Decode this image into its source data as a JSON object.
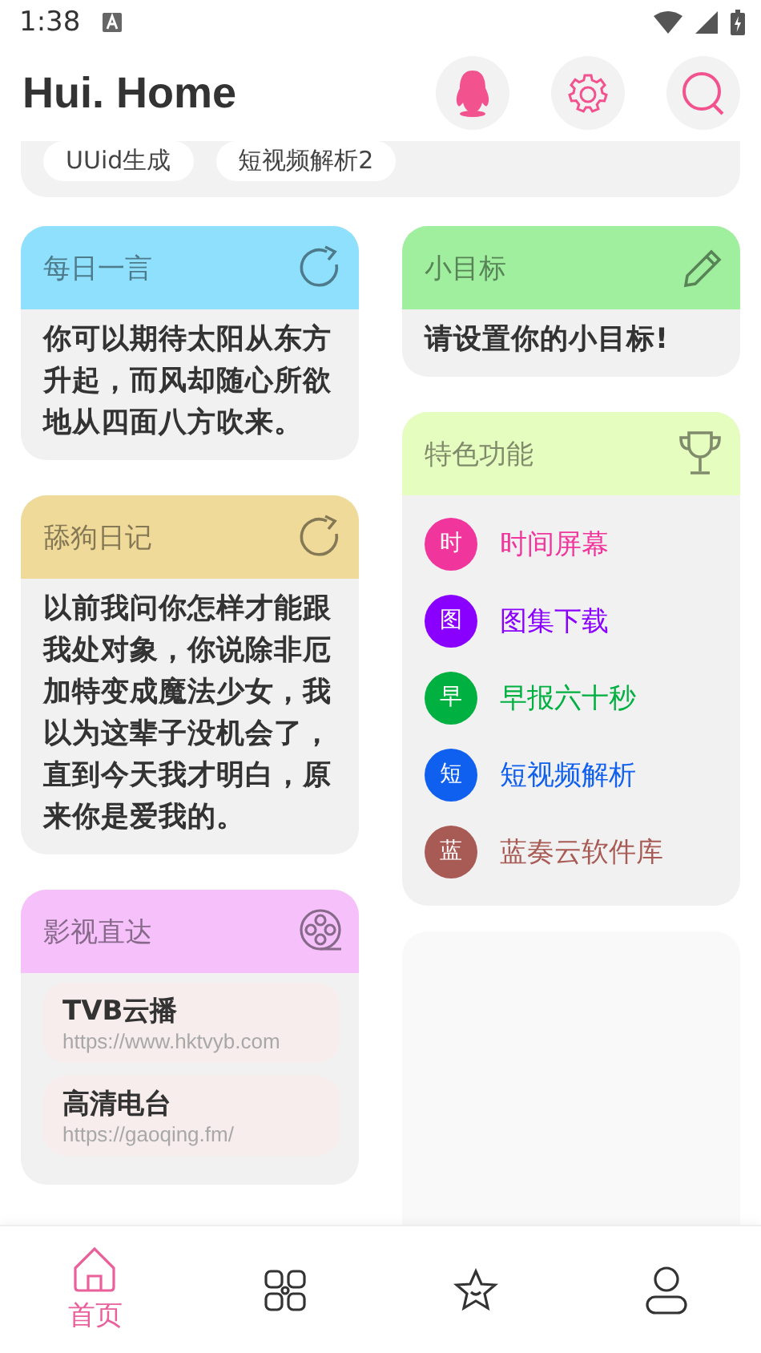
{
  "status_bar": {
    "time": "1:38"
  },
  "header": {
    "title": "Hui. Home"
  },
  "top_chips": [
    "UUid生成",
    "短视频解析2"
  ],
  "left_cards": [
    {
      "kind": "text",
      "title": "每日一言",
      "color": "#8ee0fd",
      "body": "你可以期待太阳从东方升起，而风却随心所欲地从四面八方吹来。"
    },
    {
      "kind": "text",
      "title": "舔狗日记",
      "color": "#f0da9a",
      "body": "以前我问你怎样才能跟我处对象，你说除非厄加特变成魔法少女，我以为这辈子没机会了，直到今天我才明白，原来你是爱我的。"
    },
    {
      "kind": "links",
      "title": "影视直达",
      "color": "#f6c0fb",
      "links": [
        {
          "name": "TVB云播",
          "url": "https://www.hktvyb.com"
        },
        {
          "name": "高清电台",
          "url": "https://gaoqing.fm/"
        }
      ]
    }
  ],
  "right_cards": [
    {
      "kind": "text",
      "title": "小目标",
      "color": "#a0ef9e",
      "body": "请设置你的小目标!"
    },
    {
      "kind": "list",
      "title": "特色功能",
      "color": "#e6fdc0",
      "items": [
        {
          "badge": "时",
          "label": "时间屏幕",
          "color": "#f0369c"
        },
        {
          "badge": "图",
          "label": "图集下载",
          "color": "#8a00ff"
        },
        {
          "badge": "早",
          "label": "早报六十秒",
          "color": "#00b040"
        },
        {
          "badge": "短",
          "label": "短视频解析",
          "color": "#1060f0"
        },
        {
          "badge": "蓝",
          "label": "蓝奏云软件库",
          "color": "#a85a55"
        }
      ]
    },
    {
      "kind": "empty"
    }
  ],
  "bottom_nav": [
    {
      "label": "首页",
      "selected": true
    },
    {
      "selected": false
    },
    {
      "selected": false
    },
    {
      "selected": false
    }
  ]
}
